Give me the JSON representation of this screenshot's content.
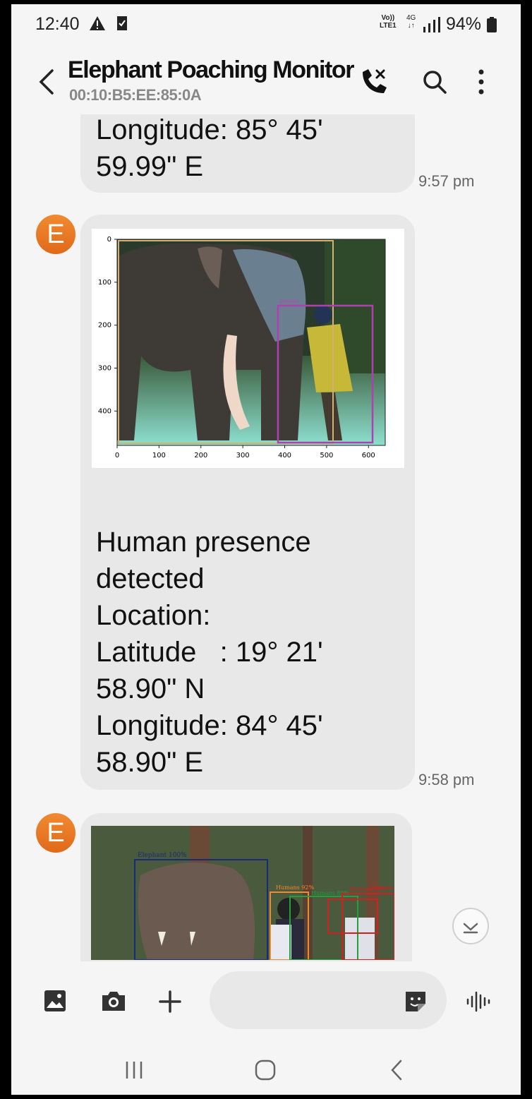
{
  "status_bar": {
    "time": "12:40",
    "volte_top": "Vo))",
    "volte_bottom": "LTE1",
    "network_type": "4G",
    "battery": "94%"
  },
  "header": {
    "title": "Elephant Poaching Monitor",
    "subtitle": "00:10:B5:EE:85:0A"
  },
  "messages": [
    {
      "text": "Longitude: 85° 45'\n59.99\" E",
      "time": "9:57 pm"
    },
    {
      "avatar": "E",
      "text": "Human presence\ndetected\nLocation:\nLatitude   : 19° 21'\n58.90\" N\nLongitude: 84° 45'\n58.90\" E",
      "time": "9:58 pm",
      "chart": {
        "x_ticks": [
          "0",
          "100",
          "200",
          "300",
          "400",
          "500",
          "600"
        ],
        "y_ticks": [
          "0",
          "100",
          "200",
          "300",
          "400"
        ],
        "box_label": "person"
      }
    },
    {
      "avatar": "E",
      "image": {
        "labels": [
          "Elephant 100%",
          "Humans 92%",
          "Humans 89%",
          "Humans 99%",
          "Humans 68%"
        ]
      }
    }
  ],
  "colors": {
    "avatar": "#e8782a",
    "bubble": "#e8e8e8",
    "background": "#f5f5f5"
  },
  "icons": {
    "back": "chevron-left-icon",
    "call": "phone-call-icon",
    "search": "search-icon",
    "more": "more-vertical-icon",
    "gallery": "image-icon",
    "camera": "camera-icon",
    "add": "plus-icon",
    "sticker": "sticker-icon",
    "voice": "voice-wave-icon",
    "scroll_down": "chevron-down-icon"
  }
}
